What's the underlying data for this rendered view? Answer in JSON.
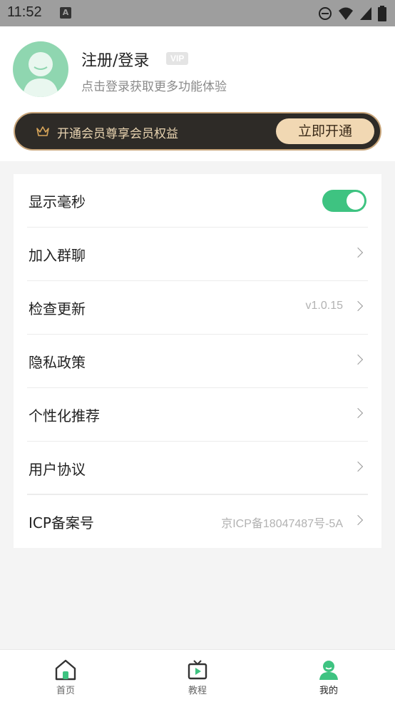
{
  "status_bar": {
    "time": "11:52",
    "notification_icon": "A"
  },
  "profile": {
    "username": "注册/登录",
    "vip_badge": "VIP",
    "hint": "点击登录获取更多功能体验"
  },
  "vip_banner": {
    "text": "开通会员尊享会员权益",
    "button": "立即开通"
  },
  "settings": {
    "items": [
      {
        "label": "显示毫秒",
        "type": "toggle",
        "on": true
      },
      {
        "label": "加入群聊",
        "type": "link"
      },
      {
        "label": "检查更新",
        "type": "link",
        "value": "v1.0.15"
      },
      {
        "label": "隐私政策",
        "type": "link"
      },
      {
        "label": "个性化推荐",
        "type": "link"
      },
      {
        "label": "用户协议",
        "type": "link"
      },
      {
        "label": "ICP备案号",
        "type": "link",
        "value": "京ICP备18047487号-5A"
      }
    ]
  },
  "bottom_nav": {
    "items": [
      {
        "label": "首页",
        "icon": "home-icon"
      },
      {
        "label": "教程",
        "icon": "tv-icon"
      },
      {
        "label": "我的",
        "icon": "user-icon",
        "active": true
      }
    ]
  },
  "colors": {
    "accent": "#3ec381",
    "vip_gold": "#f1d8b3",
    "vip_dark": "#2e2b27"
  }
}
